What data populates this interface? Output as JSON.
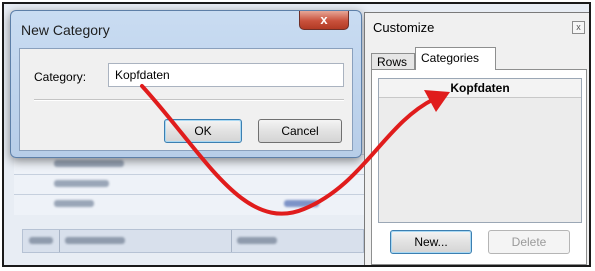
{
  "new_category_dialog": {
    "title": "New Category",
    "close_glyph": "x",
    "category_label": "Category:",
    "category_value": "Kopfdaten",
    "ok_label": "OK",
    "cancel_label": "Cancel"
  },
  "customize_panel": {
    "title": "Customize",
    "close_glyph": "x",
    "tabs": [
      {
        "label": "Rows"
      },
      {
        "label": "Categories"
      }
    ],
    "categories": [
      "Kopfdaten"
    ],
    "new_label": "New...",
    "delete_label": "Delete"
  },
  "colors": {
    "arrow": "#e01c1c",
    "title_bar": "#c9dcf2",
    "close_button": "#c9513c"
  },
  "icons": [
    "close-icon",
    "arrow-annotation"
  ]
}
